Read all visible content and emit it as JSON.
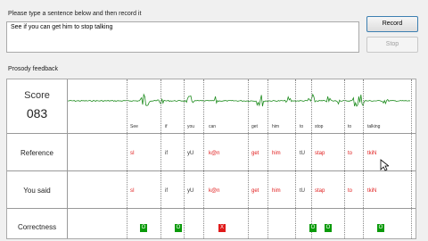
{
  "prompt": "Please type a sentence below and then record it",
  "sentence": "See if you can get him to stop talking",
  "buttons": {
    "record": "Record",
    "stop": "Stop"
  },
  "section_label": "Prosody feedback",
  "score": {
    "title": "Score",
    "value": "083"
  },
  "row_labels": {
    "reference": "Reference",
    "you_said": "You said",
    "correctness": "Correctness"
  },
  "colors": {
    "good": "#0a9a0a",
    "bad": "#e01a1a",
    "wave": "#1e8c1e"
  },
  "words": [
    {
      "word": "See",
      "ref": "sI",
      "ref_ok": false,
      "said": "sI",
      "said_ok": false,
      "mark": "O",
      "mark_ok": true
    },
    {
      "word": "if",
      "ref": "if",
      "ref_ok": true,
      "said": "if",
      "said_ok": true,
      "mark": "O",
      "mark_ok": true
    },
    {
      "word": "you",
      "ref": "yU",
      "ref_ok": true,
      "said": "yU",
      "said_ok": true,
      "mark": "",
      "mark_ok": true
    },
    {
      "word": "can",
      "ref": "k@n",
      "ref_ok": false,
      "said": "k@n",
      "said_ok": false,
      "mark": "X",
      "mark_ok": false
    },
    {
      "word": "get",
      "ref": "get",
      "ref_ok": false,
      "said": "get",
      "said_ok": false,
      "mark": "",
      "mark_ok": true
    },
    {
      "word": "him",
      "ref": "him",
      "ref_ok": false,
      "said": "him",
      "said_ok": false,
      "mark": "",
      "mark_ok": true
    },
    {
      "word": "to",
      "ref": "tU",
      "ref_ok": true,
      "said": "tU",
      "said_ok": true,
      "mark": "O",
      "mark_ok": true
    },
    {
      "word": "stop",
      "ref": "stap",
      "ref_ok": false,
      "said": "stap",
      "said_ok": false,
      "mark": "O",
      "mark_ok": true
    },
    {
      "word": "to",
      "ref": "to",
      "ref_ok": false,
      "said": "to",
      "said_ok": false,
      "mark": "",
      "mark_ok": true
    },
    {
      "word": "talking",
      "ref": "tkiN",
      "ref_ok": false,
      "said": "tkiN",
      "said_ok": false,
      "mark": "O",
      "mark_ok": true
    }
  ]
}
